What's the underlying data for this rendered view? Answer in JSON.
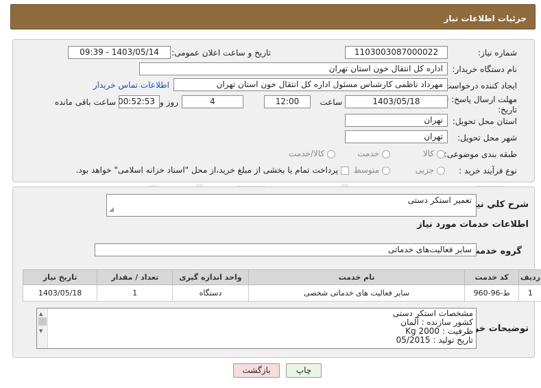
{
  "header": {
    "title": "جزئیات اطلاعات نیاز"
  },
  "fields": {
    "need_number_label": "شماره نیاز:",
    "need_number": "1103003087000022",
    "announce_label": "تاریخ و ساعت اعلان عمومی:",
    "announce_value": "1403/05/14 - 09:39",
    "buyer_label": "نام دستگاه خریدار:",
    "buyer_value": "اداره کل انتقال خون استان تهران",
    "creator_label": "ایجاد کننده درخواست:",
    "creator_value": "مهرداد ناظمی کارشناس مسئول اداره کل انتقال خون استان تهران",
    "contact_link": "اطلاعات تماس خریدار",
    "deadline_label_1": "مهلت ارسال پاسخ: تا",
    "deadline_label_2": "تاریخ:",
    "deadline_date": "1403/05/18",
    "time_label": "ساعت",
    "deadline_time": "12:00",
    "days_value": "4",
    "days_label": "روز و",
    "remaining_value": "00:52:53",
    "remaining_label": "ساعت باقی مانده",
    "province_label": "استان محل تحویل:",
    "province_value": "تهران",
    "city_label": "شهر محل تحویل:",
    "city_value": "تهران",
    "category_label": "طبقه بندی موضوعی:",
    "category_options": [
      "کالا",
      "خدمت",
      "کالا/خدمت"
    ],
    "process_label": "نوع فرآیند خرید :",
    "process_options": [
      "جزیی",
      "متوسط"
    ],
    "payment_note": "پرداخت تمام یا بخشی از مبلغ خرید،از محل \"اسناد خزانه اسلامی\" خواهد بود."
  },
  "summary": {
    "label": "شرح کلي نياز:",
    "value": "تعمیر استکر دستی",
    "services_title": "اطلاعات خدمات مورد نیاز",
    "group_label": "گروه خدمت:",
    "group_value": "سایر فعالیت‌های خدماتی"
  },
  "table": {
    "headers": [
      "ردیف",
      "کد خدمت",
      "نام خدمت",
      "واحد اندازه گیری",
      "تعداد / مقدار",
      "تاریخ نیاز"
    ],
    "rows": [
      [
        "1",
        "ط-96-960",
        "سایر فعالیت های خدماتی شخصی",
        "دستگاه",
        "1",
        "1403/05/18"
      ]
    ]
  },
  "notes": {
    "label": "توضیحات خریدار:",
    "lines": [
      "مشخصات استکر دستی",
      "کشور سازنده : آلمان",
      "ظرفیت :   Kg 2000",
      "تاریخ تولید : 05/2015"
    ]
  },
  "buttons": {
    "print": "چاپ",
    "back": "بازگشت"
  },
  "colors": {
    "header_bg": "#8f6a3c",
    "link": "#1a4fb8",
    "back_button": "#f6dcdc",
    "print_button": "#e9f6e4"
  }
}
